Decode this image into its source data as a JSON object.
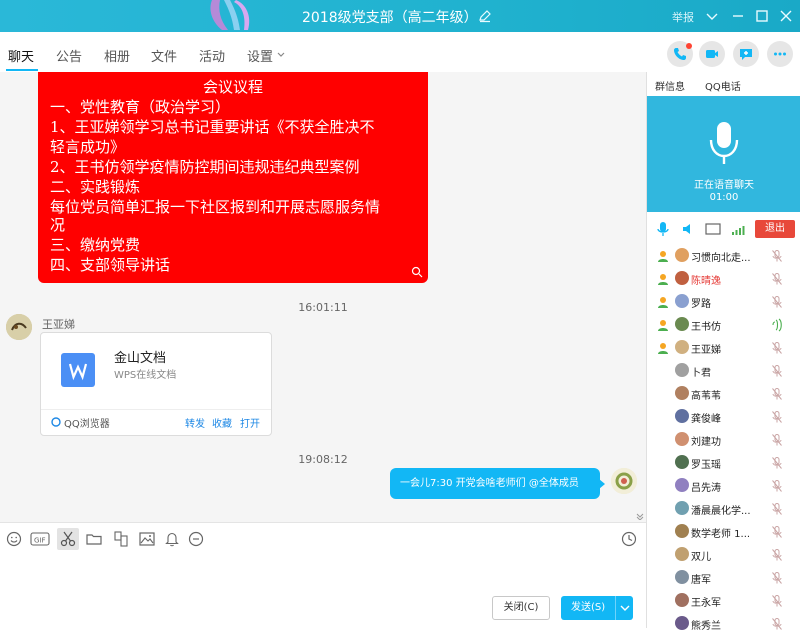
{
  "window": {
    "title": "2018级党支部（高二年级）",
    "report_label": "举报"
  },
  "tabs": [
    "聊天",
    "公告",
    "相册",
    "文件",
    "活动",
    "设置"
  ],
  "red_card": {
    "title": "会议议程",
    "lines": [
      "一、党性教育（政治学习）",
      "1、王亚娣领学习总书记重要讲话《不获全胜决不",
      "轻言成功》",
      "2、王书仿领学疫情防控期间违规违纪典型案例",
      "二、实践锻炼",
      "每位党员简单汇报一下社区报到和开展志愿服务情",
      "况",
      "三、缴纳党费",
      "四、支部领导讲话"
    ]
  },
  "messages": {
    "time1": "16:01:11",
    "sender1": "王亚娣",
    "doc_card": {
      "title": "金山文档",
      "subtitle": "WPS在线文档",
      "source": "QQ浏览器",
      "forward": "转发",
      "favorite": "收藏",
      "open": "打开"
    },
    "time2": "19:08:12",
    "bubble": "一会儿7:30 开党会啥老师们 @全体成员"
  },
  "input": {
    "close_label": "关闭(C)",
    "send_label": "发送(S)"
  },
  "right_panel": {
    "tab_info": "群信息",
    "tab_call": "QQ电话",
    "voice_status": "正在语音聊天",
    "voice_timer": "01:00",
    "exit_label": "退出",
    "members": [
      {
        "name": "习惯向北走...",
        "admin": true,
        "color": "#222",
        "speaking": false
      },
      {
        "name": "陈晴逸",
        "admin": true,
        "color": "#e53935",
        "speaking": false
      },
      {
        "name": "罗路",
        "admin": true,
        "color": "#222",
        "speaking": false
      },
      {
        "name": "王书仿",
        "admin": true,
        "color": "#222",
        "speaking": true
      },
      {
        "name": "王亚娣",
        "admin": true,
        "color": "#222",
        "speaking": false
      },
      {
        "name": "卜君",
        "admin": false,
        "color": "#222",
        "speaking": false
      },
      {
        "name": "高苇苇",
        "admin": false,
        "color": "#222",
        "speaking": false
      },
      {
        "name": "龚俊峰",
        "admin": false,
        "color": "#222",
        "speaking": false
      },
      {
        "name": "刘建功",
        "admin": false,
        "color": "#222",
        "speaking": false
      },
      {
        "name": "罗玉瑶",
        "admin": false,
        "color": "#222",
        "speaking": false
      },
      {
        "name": "吕先涛",
        "admin": false,
        "color": "#222",
        "speaking": false
      },
      {
        "name": "潘晨晨化学...",
        "admin": false,
        "color": "#222",
        "speaking": false
      },
      {
        "name": "数学老师 1...",
        "admin": false,
        "color": "#222",
        "speaking": false
      },
      {
        "name": "双儿",
        "admin": false,
        "color": "#222",
        "speaking": false
      },
      {
        "name": "唐军",
        "admin": false,
        "color": "#222",
        "speaking": false
      },
      {
        "name": "王永军",
        "admin": false,
        "color": "#222",
        "speaking": false
      },
      {
        "name": "熊秀兰",
        "admin": false,
        "color": "#222",
        "speaking": false
      }
    ]
  }
}
